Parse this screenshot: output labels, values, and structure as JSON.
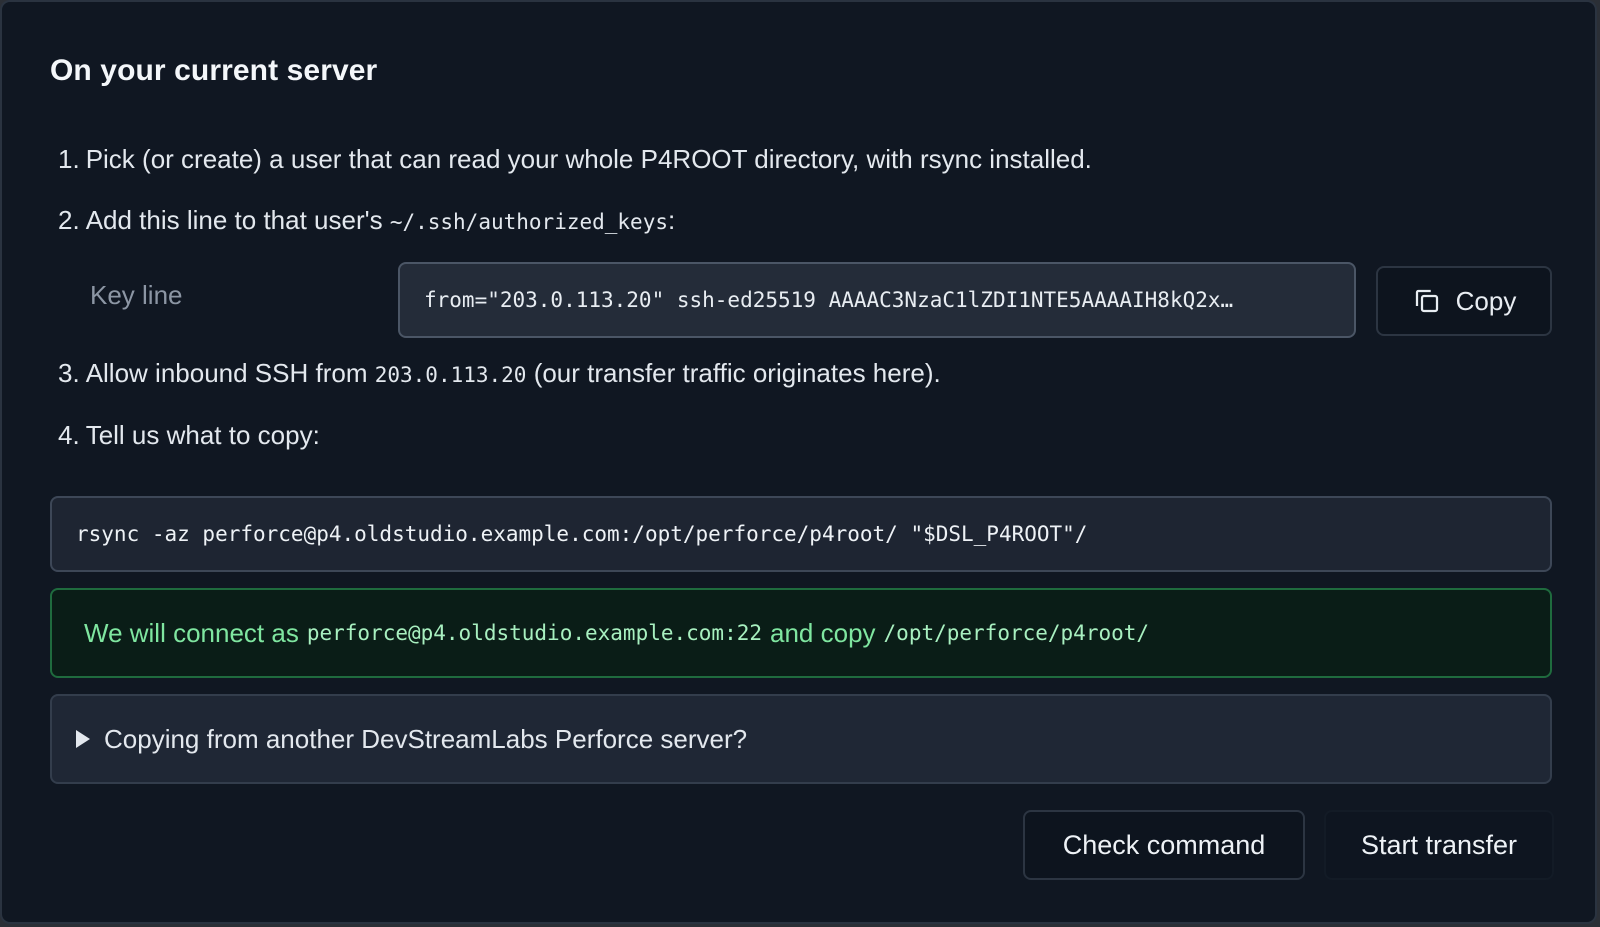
{
  "section": {
    "title": "On your current server"
  },
  "steps": [
    {
      "number": "1.",
      "text": "Pick (or create) a user that can read your whole P4ROOT directory, with rsync installed."
    },
    {
      "number": "2.",
      "text_before": "Add this line to that user's",
      "code": "~/.ssh/authorized_keys",
      "text_after": ":"
    },
    {
      "number": "3.",
      "text_before": "Allow inbound SSH from",
      "code": "203.0.113.20",
      "text_after": "(our transfer traffic originates here)."
    },
    {
      "number": "4.",
      "text": "Tell us what to copy:"
    }
  ],
  "key": {
    "label": "Key line",
    "value": "from=\"203.0.113.20\" ssh-ed25519 AAAAC3NzaC1lZDI1NTE5AAAAIH8kQ2x…",
    "copy_label": "Copy"
  },
  "command": {
    "value": "rsync -az perforce@p4.oldstudio.example.com:/opt/perforce/p4root/ \"$DSL_P4ROOT\"/"
  },
  "status": {
    "prefix": "We will connect as",
    "host": "perforce@p4.oldstudio.example.com:22",
    "middle": "and copy",
    "path": "/opt/perforce/p4root/",
    "color": "#7fe6a0"
  },
  "details": {
    "summary": "Copying from another DevStreamLabs Perforce server?"
  },
  "actions": {
    "check_label": "Check command",
    "start_label": "Start transfer"
  }
}
